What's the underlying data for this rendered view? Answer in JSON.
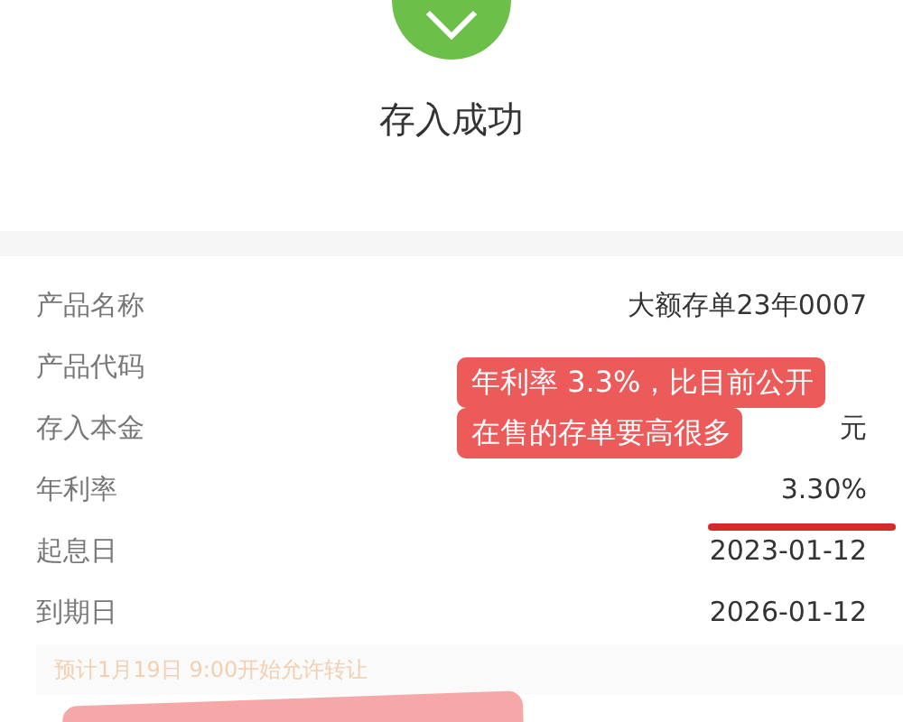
{
  "status": {
    "title": "存入成功"
  },
  "details": [
    {
      "label": "产品名称",
      "value": "大额存单23年0007"
    },
    {
      "label": "产品代码"
    },
    {
      "label": "存入本金",
      "value": "元"
    },
    {
      "label": "年利率",
      "value": "3.30%"
    },
    {
      "label": "起息日",
      "value": "2023-01-12"
    },
    {
      "label": "到期日",
      "value": "2026-01-12"
    }
  ],
  "notice": "预计1月19日 9:00开始允许转让",
  "annotation": {
    "lines": [
      "年利率 3.3%，比目前公开",
      "在售的存单要高很多"
    ]
  }
}
